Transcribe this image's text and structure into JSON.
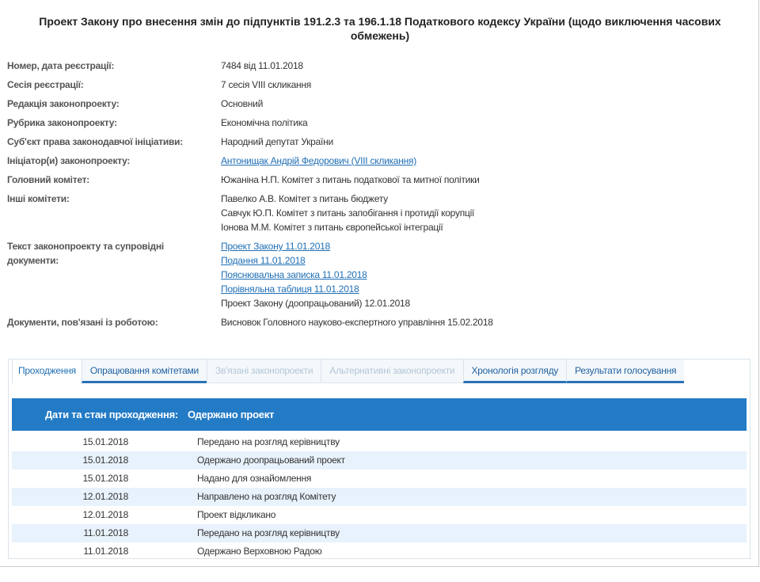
{
  "title": "Проект Закону про внесення змін до підпунктів 191.2.3 та 196.1.18 Податкового кодексу України (щодо виключення часових обмежень)",
  "info": [
    {
      "label": "Номер, дата реєстрації:",
      "values": [
        "7484 від 11.01.2018"
      ]
    },
    {
      "label": "Сесія реєстрації:",
      "values": [
        "7 сесія VIII скликання"
      ]
    },
    {
      "label": "Редакція законопроекту:",
      "values": [
        "Основний"
      ]
    },
    {
      "label": "Рубрика законопроекту:",
      "values": [
        "Економічна політика"
      ]
    },
    {
      "label": "Суб'єкт права законодавчої ініціативи:",
      "values": [
        "Народний депутат України"
      ]
    },
    {
      "label": "Ініціатор(и) законопроекту:",
      "links": [
        "Антонищак Андрій Федорович (VIII скликання)"
      ]
    },
    {
      "label": "Головний комітет:",
      "values": [
        "Южаніна Н.П. Комітет з питань податкової та митної політики"
      ]
    },
    {
      "label": "Інші комітети:",
      "values": [
        "Павелко А.В. Комітет з питань бюджету",
        "Савчук Ю.П. Комітет з питань запобігання і протидії корупції",
        "Іонова М.М. Комітет з питань європейської інтеграції"
      ]
    },
    {
      "label": "Текст законопроекту та супровідні документи:",
      "links": [
        "Проект Закону 11.01.2018",
        "Подання 11.01.2018",
        "Пояснювальна записка 11.01.2018",
        "Порівняльна таблиця 11.01.2018"
      ],
      "values": [
        "Проект Закону (доопрацьований) 12.01.2018"
      ]
    },
    {
      "label": "Документи, пов'язані із роботою:",
      "values": [
        "Висновок Головного науково-експертного управління 15.02.2018"
      ]
    }
  ],
  "tabs": [
    "Проходження",
    "Опрацювання комітетами",
    "Зв'язані законопроекти",
    "Альтернативні законопроекти",
    "Хронологія розгляду",
    "Результати голосування"
  ],
  "table": {
    "header_label": "Дати та стан проходження:",
    "header_status": "Одержано проект",
    "rows": [
      {
        "date": "15.01.2018",
        "status": "Передано на розгляд керівництву"
      },
      {
        "date": "15.01.2018",
        "status": "Одержано доопрацьований проект"
      },
      {
        "date": "15.01.2018",
        "status": "Надано для ознайомлення"
      },
      {
        "date": "12.01.2018",
        "status": "Направлено на розгляд Комітету"
      },
      {
        "date": "12.01.2018",
        "status": "Проект відкликано"
      },
      {
        "date": "11.01.2018",
        "status": "Передано на розгляд керівництву"
      },
      {
        "date": "11.01.2018",
        "status": "Одержано Верховною Радою"
      }
    ]
  }
}
